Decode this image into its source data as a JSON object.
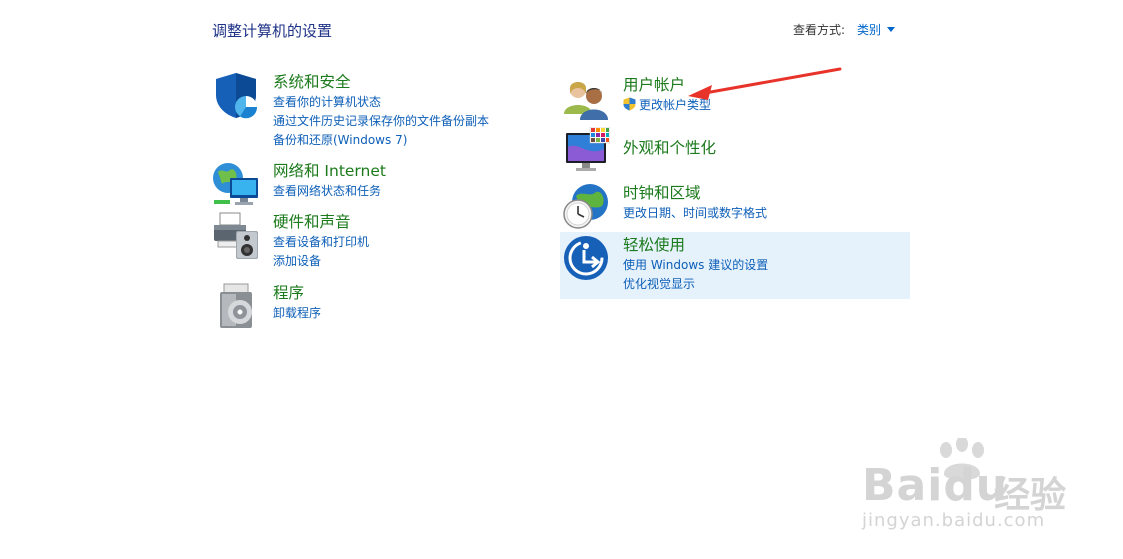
{
  "header": {
    "title": "调整计算机的设置",
    "view_by_label": "查看方式:",
    "view_by_value": "类别"
  },
  "left_categories": [
    {
      "title": "系统和安全",
      "icon": "shield-icon",
      "links": [
        "查看你的计算机状态",
        "通过文件历史记录保存你的文件备份副本",
        "备份和还原(Windows 7)"
      ]
    },
    {
      "title": "网络和 Internet",
      "icon": "network-globe-icon",
      "links": [
        "查看网络状态和任务"
      ]
    },
    {
      "title": "硬件和声音",
      "icon": "printer-speaker-icon",
      "links": [
        "查看设备和打印机",
        "添加设备"
      ]
    },
    {
      "title": "程序",
      "icon": "programs-disc-icon",
      "links": [
        "卸载程序"
      ]
    }
  ],
  "right_categories": [
    {
      "title": "用户帐户",
      "icon": "users-icon",
      "links": [
        "更改帐户类型"
      ]
    },
    {
      "title": "外观和个性化",
      "icon": "monitor-palette-icon",
      "links": []
    },
    {
      "title": "时钟和区域",
      "icon": "clock-globe-icon",
      "links": [
        "更改日期、时间或数字格式"
      ]
    },
    {
      "title": "轻松使用",
      "icon": "ease-of-access-icon",
      "links": [
        "使用 Windows 建议的设置",
        "优化视觉显示"
      ]
    }
  ],
  "annotation": {
    "arrow_color": "#e8332a"
  },
  "watermark": {
    "brand": "Bai",
    "brand2": "du",
    "name": "经验",
    "url": "jingyan.baidu.com"
  }
}
